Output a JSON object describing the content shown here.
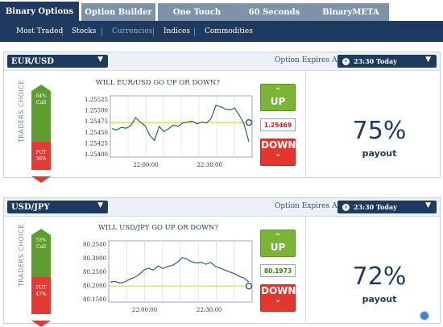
{
  "tabs": [
    {
      "label": "Binary Options",
      "active": true
    },
    {
      "label": "Option Builder",
      "active": false
    },
    {
      "label": "One Touch",
      "active": false
    },
    {
      "label": "60 Seconds",
      "active": false
    },
    {
      "label": "BinaryMETA",
      "active": false
    }
  ],
  "subnav": [
    {
      "label": "Most Traded"
    },
    {
      "label": "Stocks"
    },
    {
      "label": "Currencies"
    },
    {
      "label": "Indices"
    },
    {
      "label": "Commodities"
    }
  ],
  "panels": [
    {
      "asset": "EUR/USD",
      "expires_label": "Option Expires At:",
      "expiry": "23:30 Today",
      "traders_choice": "TRADERS CHOICE",
      "call_pct": "64%",
      "call_label": "Call",
      "put_label": "PUT",
      "put_pct": "36%",
      "call_fraction": 0.64,
      "question": "WILL EUR/USD GO UP OR DOWN?",
      "up_label": "UP",
      "down_label": "DOWN",
      "price": "1.25469",
      "payout_pct": "75%",
      "payout_label": "payout"
    },
    {
      "asset": "USD/JPY",
      "expires_label": "Option Expires At:",
      "expiry": "23:30 Today",
      "traders_choice": "TRADERS CHOICE",
      "call_pct": "53%",
      "call_label": "Call",
      "put_label": "PUT",
      "put_pct": "47%",
      "call_fraction": 0.53,
      "question": "WILL USD/JPY GO UP OR DOWN?",
      "up_label": "UP",
      "down_label": "DOWN",
      "price": "80.1973",
      "payout_pct": "72%",
      "payout_label": "payout"
    }
  ],
  "chart_data": [
    {
      "type": "line",
      "title": "",
      "xlabel": "",
      "ylabel": "",
      "y_ticks": [
        "1.25525",
        "1.25500",
        "1.25475",
        "1.25450",
        "1.25425",
        "1.25400"
      ],
      "x_ticks": [
        "22:00:00",
        "22:30:00"
      ],
      "ylim": [
        1.2539,
        1.2553
      ],
      "strike": 1.25469,
      "series": [
        {
          "values": [
            1.25455,
            1.25452,
            1.25458,
            1.25456,
            1.25462,
            1.2548,
            1.2547,
            1.25462,
            1.2544,
            1.25428,
            1.2546,
            1.25448,
            1.25455,
            1.25463,
            1.2546,
            1.25468,
            1.2547,
            1.25472,
            1.25466,
            1.2547,
            1.25468,
            1.25478,
            1.25508,
            1.25505,
            1.255,
            1.25498,
            1.25502,
            1.25485,
            1.25465,
            1.25425
          ]
        }
      ]
    },
    {
      "type": "line",
      "title": "",
      "xlabel": "",
      "ylabel": "",
      "y_ticks": [
        "80.2500",
        "80.3000",
        "80.2500",
        "80.2000",
        "80.1500"
      ],
      "x_ticks": [
        "22:00:00",
        "22:30:00"
      ],
      "ylim": [
        80.14,
        80.36
      ],
      "strike": 80.1973,
      "series": [
        {
          "values": [
            80.212,
            80.214,
            80.208,
            80.212,
            80.222,
            80.228,
            80.238,
            80.255,
            80.262,
            80.255,
            80.27,
            80.26,
            80.268,
            80.272,
            80.282,
            80.3,
            80.295,
            80.285,
            80.28,
            80.283,
            80.276,
            80.282,
            80.268,
            80.262,
            80.255,
            80.248,
            80.242,
            80.232,
            80.226,
            80.212
          ]
        }
      ]
    }
  ]
}
